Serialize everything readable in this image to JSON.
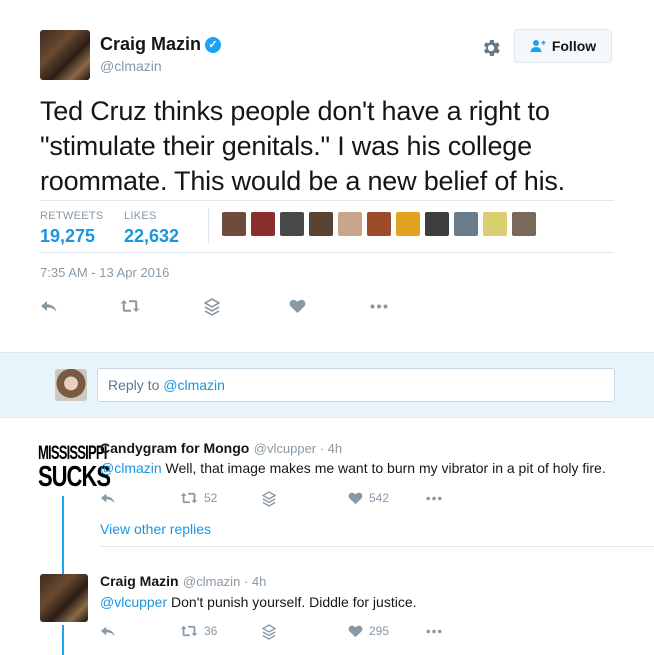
{
  "tweet": {
    "author_name": "Craig Mazin",
    "author_handle": "@clmazin",
    "follow_label": "Follow",
    "text": "Ted Cruz thinks people don't have a right to \"stimulate their genitals.\" I was his college roommate. This would be a new belief of his.",
    "retweets_label": "RETWEETS",
    "retweets_count": "19,275",
    "likes_label": "LIKES",
    "likes_count": "22,632",
    "timestamp": "7:35 AM - 13 Apr 2016",
    "liker_colors": [
      "#6e4b3a",
      "#8a2f2f",
      "#4a4a4a",
      "#5a4330",
      "#c9a58c",
      "#9c4a2a",
      "#e0a020",
      "#3d3d3d",
      "#6b7d8a",
      "#d8d070",
      "#7a6a5a"
    ]
  },
  "reply_composer": {
    "prefix": "Reply to ",
    "mention": "@clmazin"
  },
  "replies": [
    {
      "avatar_text_1": "MISSISSIPPI",
      "avatar_text_2": "SUCKS",
      "name": "Candygram for Mongo",
      "meta": "@vlcupper · 4h",
      "mention": "@clmazin",
      "text": " Well, that image makes me want to burn my vibrator in a pit of holy fire.",
      "retweet_count": "52",
      "like_count": "542"
    },
    {
      "name": "Craig Mazin",
      "meta": "@clmazin · 4h",
      "mention": "@vlcupper",
      "text": " Don't punish yourself. Diddle for justice.",
      "retweet_count": "36",
      "like_count": "295"
    }
  ],
  "view_other_replies": "View other replies",
  "colors": {
    "accent": "#1b95e0",
    "verified": "#1da1f2",
    "muted": "#8899a6",
    "reply_bg": "#e8f4fb"
  }
}
